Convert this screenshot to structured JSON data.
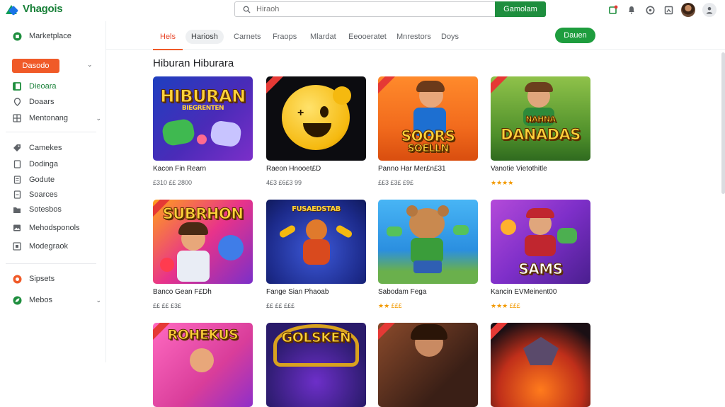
{
  "app": {
    "logo_text": "Vhagois"
  },
  "search": {
    "placeholder": "Hiraoh",
    "button_label": "Gamolam"
  },
  "colors": {
    "accent": "#f05a28",
    "primary_green": "#1e8e3e",
    "rating": "#f29900"
  },
  "sidebar": {
    "header": {
      "label": "Marketplace",
      "icon": "store-icon"
    },
    "primary_button": "Dasodo",
    "items_a": [
      {
        "label": "Dieoara",
        "icon": "grid-icon",
        "active": true
      },
      {
        "label": "Doaars",
        "icon": "pin-icon"
      },
      {
        "label": "Mentonang",
        "icon": "menu-icon",
        "expandable": true
      }
    ],
    "items_b": [
      {
        "label": "Camekes",
        "icon": "tag-icon"
      },
      {
        "label": "Dodinga",
        "icon": "doc-icon"
      },
      {
        "label": "Godute",
        "icon": "note-icon"
      },
      {
        "label": "Soarces",
        "icon": "list-icon"
      },
      {
        "label": "Sotesbos",
        "icon": "folder-icon"
      },
      {
        "label": "Mehodsponols",
        "icon": "image-icon"
      },
      {
        "label": "Modegraok",
        "icon": "square-icon"
      }
    ],
    "items_c": [
      {
        "label": "Sipsets",
        "icon": "sports-icon"
      },
      {
        "label": "Mebos",
        "icon": "leaf-icon",
        "expandable": true
      }
    ]
  },
  "tabs": [
    {
      "label": "Hels",
      "state": "active"
    },
    {
      "label": "Hariosh",
      "state": "pill"
    },
    {
      "label": "Carnets",
      "state": "normal"
    },
    {
      "label": "Fraops",
      "state": "normal"
    },
    {
      "label": "Mlardat",
      "state": "normal"
    },
    {
      "label": "Eeooeratet",
      "state": "normal"
    },
    {
      "label": "Mnrestors",
      "state": "normal"
    },
    {
      "label": "Doys",
      "state": "normal"
    }
  ],
  "tabs_action": "Dauen",
  "section_title": "Hiburan Hiburara",
  "cards": [
    {
      "title": "Kacon Fin Rearn",
      "meta": "£310 ££ 2800",
      "art_text": "HIBURAN",
      "art_sub": "BIEGRENTEN"
    },
    {
      "title": "Raeon Hnooet£D",
      "meta": "4£3 £6£3 99",
      "art_text": "",
      "art_sub": ""
    },
    {
      "title": "Panno Har Mer£n£31",
      "meta": "££3 £3£ £9£",
      "art_text": "SOORS",
      "art_sub": "SOELLN"
    },
    {
      "title": "Vanotie Vietothitle",
      "meta": "★★★★",
      "art_text": "DANADAS",
      "art_sub": "NAHNA"
    },
    {
      "title": "Banco Gean F£Dh",
      "meta": "££ ££ £3£",
      "art_text": "SUBRHON",
      "art_sub": ""
    },
    {
      "title": "Fange Sian Phaoab",
      "meta": "££ ££ £££",
      "art_text": "FUSAEDSTAB",
      "art_sub": ""
    },
    {
      "title": "Sabodam Fega",
      "meta": "★★ £££",
      "art_text": "",
      "art_sub": ""
    },
    {
      "title": "Kancin EVMeinent00",
      "meta": "★★★ £££",
      "art_text": "SAMS",
      "art_sub": ""
    },
    {
      "title": "",
      "meta": "",
      "art_text": "ROHEKUS",
      "art_sub": ""
    },
    {
      "title": "",
      "meta": "",
      "art_text": "GOLSKEN",
      "art_sub": ""
    },
    {
      "title": "",
      "meta": "",
      "art_text": "",
      "art_sub": ""
    },
    {
      "title": "",
      "meta": "",
      "art_text": "",
      "art_sub": ""
    }
  ]
}
